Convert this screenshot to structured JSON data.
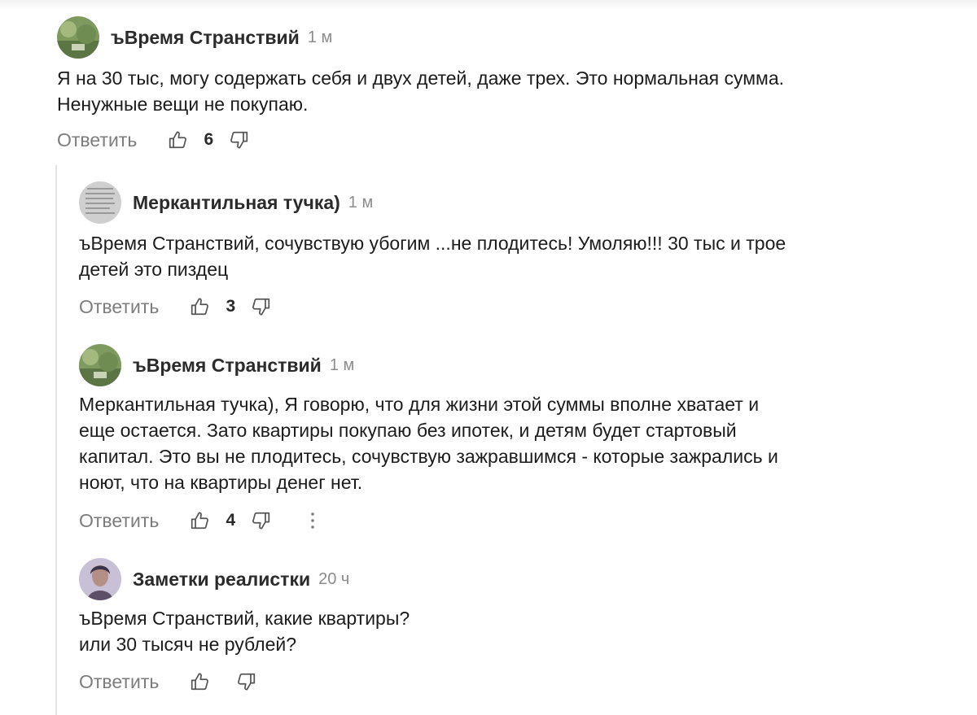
{
  "comments": [
    {
      "author": "ъВремя Странствий",
      "time": "1 м",
      "text": "Я на 30 тыс, могу содержать себя и двух детей, даже трех. Это нормальная сумма.\nНенужные вещи не покупаю.",
      "reply_label": "Ответить",
      "likes": "6"
    },
    {
      "author": "Меркантильная тучка)",
      "time": "1 м",
      "text": "ъВремя Странствий, сочувствую убогим ...не плодитесь! Умоляю!!! 30 тыс и трое\nдетей это пиздец",
      "reply_label": "Ответить",
      "likes": "3"
    },
    {
      "author": "ъВремя Странствий",
      "time": "1 м",
      "text": "Меркантильная тучка), Я говорю, что для жизни этой суммы вполне хватает и\nеще остается. Зато квартиры покупаю без ипотек, и детям будет стартовый\nкапитал. Это вы не плодитесь, сочувствую зажравшимся - которые зажрались и\nноют, что на квартиры денег нет.",
      "reply_label": "Ответить",
      "likes": "4"
    },
    {
      "author": "Заметки реалистки",
      "time": "20 ч",
      "text": "ъВремя Странствий, какие квартиры?\nили 30 тысяч не рублей?",
      "reply_label": "Ответить",
      "likes": ""
    }
  ],
  "icons": {
    "like": "thumb-up-icon",
    "dislike": "thumb-down-icon",
    "more": "more-vertical-icon"
  },
  "colors": {
    "text": "#1c1c1c",
    "muted": "#7d7d7d",
    "thread_line": "#e3e3e3"
  }
}
